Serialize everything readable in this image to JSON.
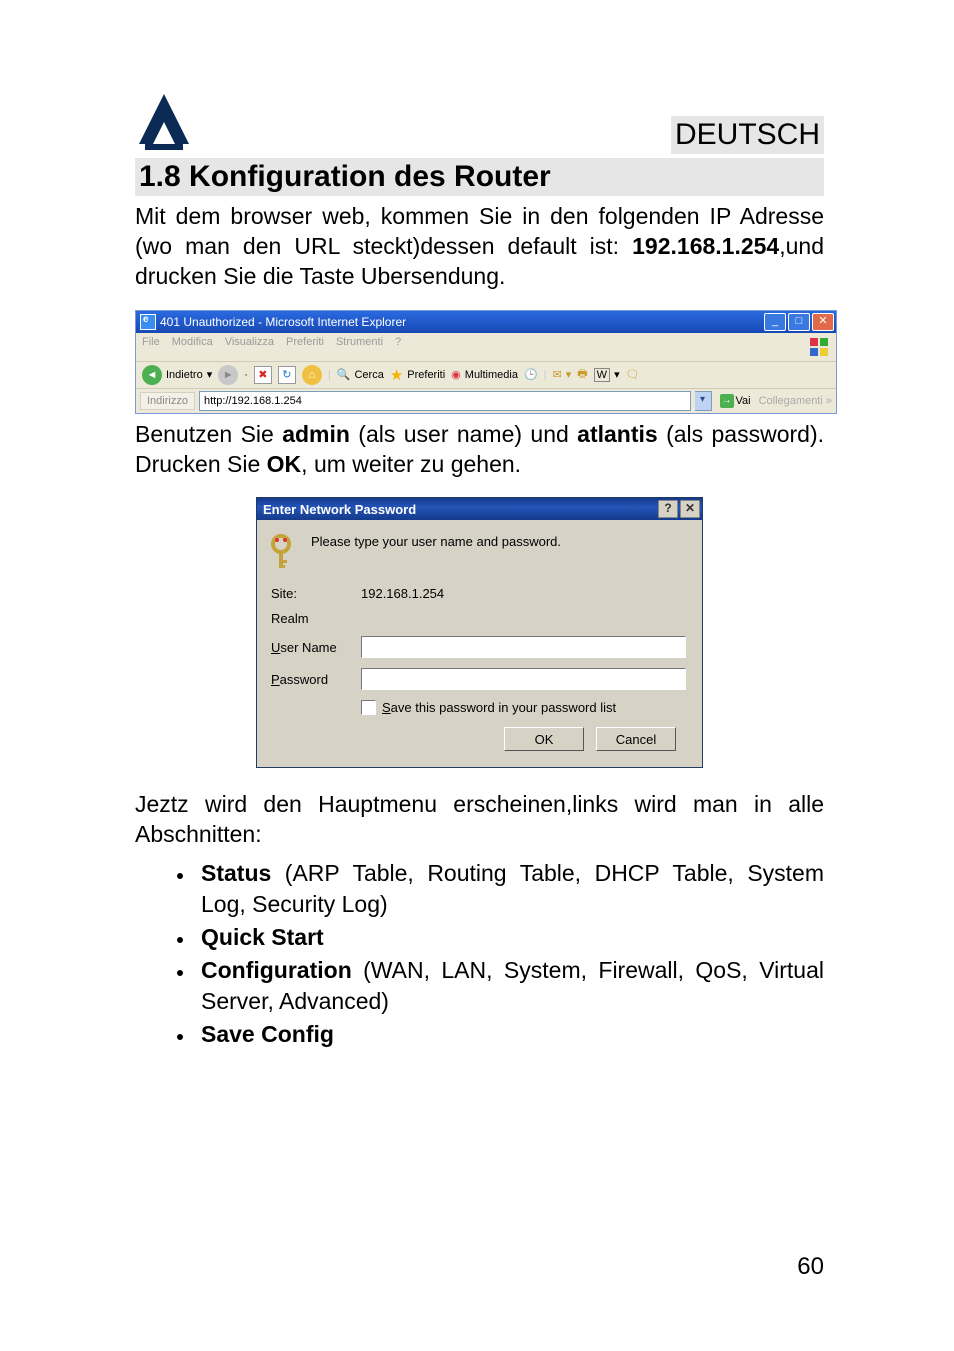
{
  "header": {
    "language": "DEUTSCH",
    "section_title": "1.8 Konfiguration des Router"
  },
  "paragraphs": {
    "p1_a": "Mit dem browser web, kommen Sie in den folgenden IP Adresse (wo man den URL steckt)dessen default ist: ",
    "p1_bold": "192.168.1.254",
    "p1_b": ",und drucken Sie die Taste Ubersendung.",
    "p2_a": "Benutzen Sie ",
    "p2_admin": "admin",
    "p2_b": " (als user name) und ",
    "p2_atlantis": "atlantis",
    "p2_c": " (als password). Drucken Sie ",
    "p2_ok": "OK",
    "p2_d": ", um weiter zu gehen.",
    "p3": "Jeztz wird den Hauptmenu erscheinen,links wird man in alle Abschnitten:"
  },
  "ie": {
    "title": "401 Unauthorized - Microsoft Internet Explorer",
    "menus": [
      "File",
      "Modifica",
      "Visualizza",
      "Preferiti",
      "Strumenti",
      "?"
    ],
    "toolbar": {
      "back": "Indietro",
      "search": "Cerca",
      "favorites": "Preferiti",
      "media": "Multimedia"
    },
    "address_label": "Indirizzo",
    "address_value": "http://192.168.1.254",
    "go_label": "Vai",
    "links_label": "Collegamenti"
  },
  "dialog": {
    "title": "Enter Network Password",
    "intro": "Please type your user name and password.",
    "site_lbl": "Site:",
    "site_val": "192.168.1.254",
    "realm_lbl": "Realm",
    "user_lbl": "User Name",
    "pass_lbl": "Password",
    "save_lbl": "Save this password in your password list",
    "ok": "OK",
    "cancel": "Cancel",
    "user_value": "",
    "pass_value": ""
  },
  "list": {
    "i1_bold": "Status",
    "i1_rest": " (ARP Table, Routing Table, DHCP Table, System Log, Security Log)",
    "i2_bold": "Quick Start",
    "i3_bold": "Configuration",
    "i3_rest": " (WAN, LAN, System, Firewall, QoS, Virtual Server, Advanced)",
    "i4_bold": "Save Config"
  },
  "page_number": "60"
}
